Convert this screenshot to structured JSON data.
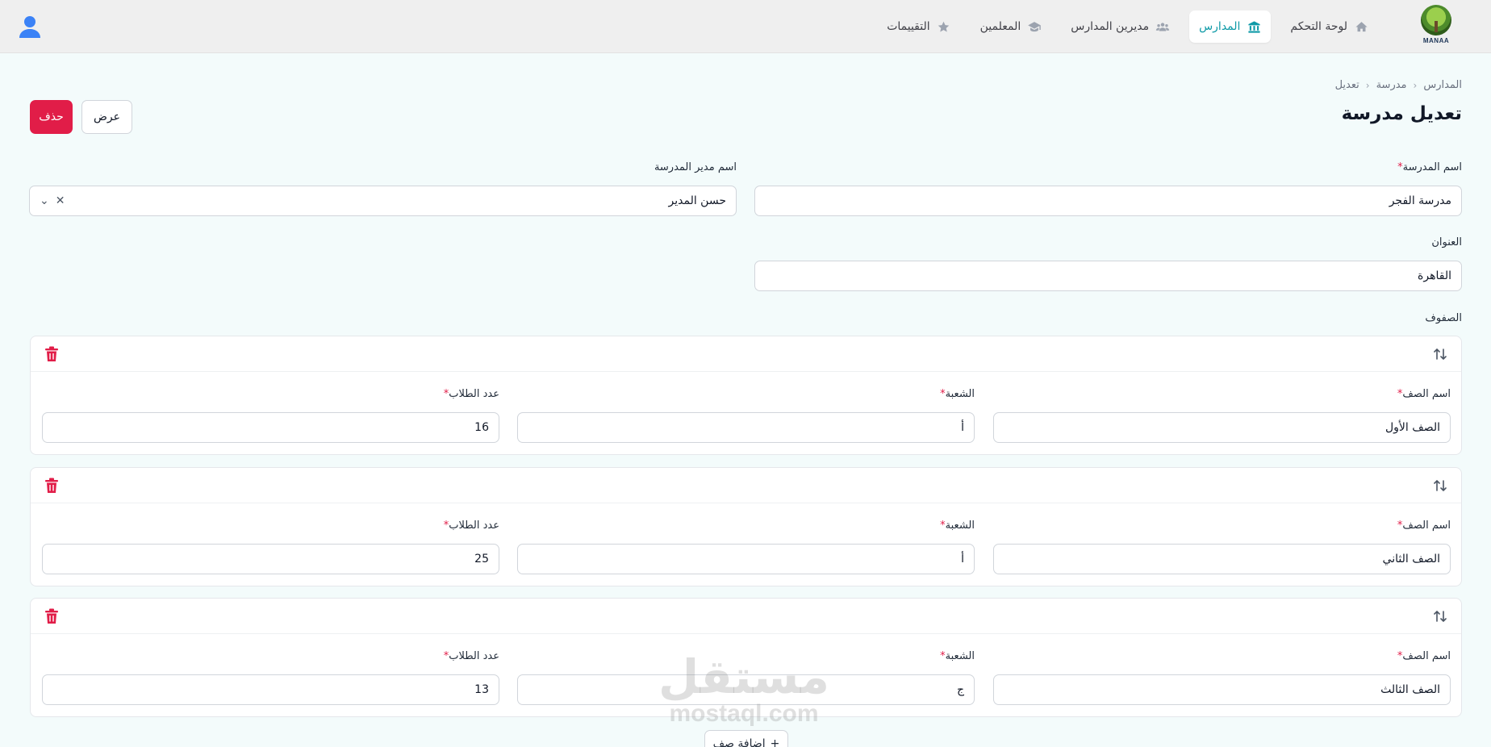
{
  "brand": {
    "logo_text": "MANAA"
  },
  "nav": {
    "items": [
      {
        "label": "لوحة التحكم",
        "icon": "home-icon",
        "active": false
      },
      {
        "label": "المدارس",
        "icon": "school-icon",
        "active": true
      },
      {
        "label": "مديرين المدارس",
        "icon": "users-icon",
        "active": false
      },
      {
        "label": "المعلمين",
        "icon": "graduation-cap-icon",
        "active": false
      },
      {
        "label": "التقييمات",
        "icon": "star-icon",
        "active": false
      }
    ],
    "active_color": "#0e9aa7"
  },
  "breadcrumb": {
    "items": [
      "المدارس",
      "مدرسة",
      "تعديل"
    ]
  },
  "page": {
    "title": "تعديل مدرسة"
  },
  "actions": {
    "view_label": "عرض",
    "delete_label": "حذف",
    "delete_color": "#e11d48"
  },
  "form": {
    "school_name": {
      "label": "اسم المدرسة",
      "value": "مدرسة الفجر",
      "required": true
    },
    "manager_name": {
      "label": "اسم مدير المدرسة",
      "value": "حسن المدير"
    },
    "address": {
      "label": "العنوان",
      "value": "القاهرة"
    },
    "classes_label": "الصفوف",
    "classes": [
      {
        "class_name_label": "اسم الصف",
        "class_name": "الصف الأول",
        "section_label": "الشعبة",
        "section": "أ",
        "students_label": "عدد الطلاب",
        "students": "16"
      },
      {
        "class_name_label": "اسم الصف",
        "class_name": "الصف الثاني",
        "section_label": "الشعبة",
        "section": "أ",
        "students_label": "عدد الطلاب",
        "students": "25"
      },
      {
        "class_name_label": "اسم الصف",
        "class_name": "الصف الثالث",
        "section_label": "الشعبة",
        "section": "ج",
        "students_label": "عدد الطلاب",
        "students": "13"
      }
    ],
    "add_class_label": "إضافة صف"
  },
  "watermark": {
    "arabic": "مستقل",
    "latin": "mostaql.com"
  }
}
